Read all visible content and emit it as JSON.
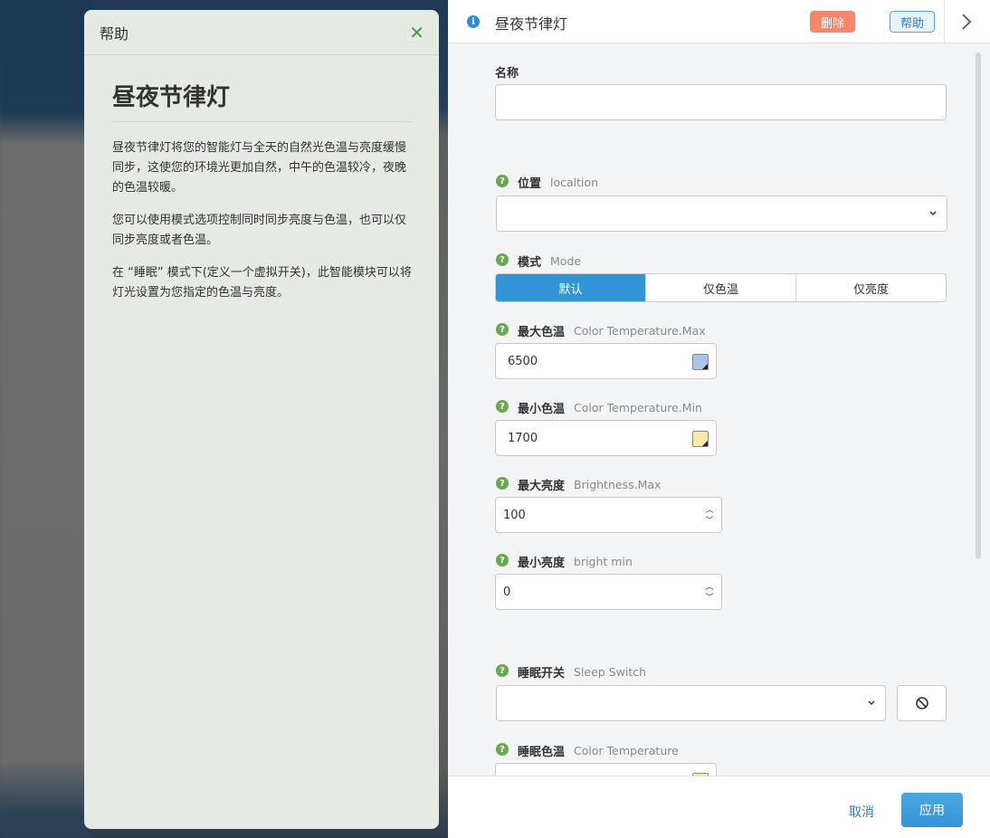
{
  "help": {
    "header_title": "帮助",
    "close_glyph": "✕",
    "title": "昼夜节律灯",
    "paragraphs": [
      "昼夜节律灯将您的智能灯与全天的自然光色温与亮度缓慢同步，这使您的环境光更加自然，中午的色温较冷，夜晚的色温较暖。",
      "您可以使用模式选项控制同时同步亮度与色温，也可以仅同步亮度或者色温。",
      "在 “睡眠” 模式下(定义一个虚拟开关)，此智能模块可以将灯光设置为您指定的色温与亮度。"
    ]
  },
  "panel": {
    "title": "昼夜节律灯",
    "delete_label": "删除",
    "help_label": "帮助",
    "info_glyph": "i"
  },
  "form": {
    "name": {
      "label": "名称",
      "value": ""
    },
    "location": {
      "label": "位置",
      "sub": "localtion",
      "value": ""
    },
    "mode": {
      "label": "模式",
      "sub": "Mode",
      "options": [
        "默认",
        "仅色温",
        "仅亮度"
      ],
      "selected": "默认"
    },
    "color_temp_max": {
      "label": "最大色温",
      "sub": "Color Temperature.Max",
      "value": "6500",
      "swatch": "#a9c6ea"
    },
    "color_temp_min": {
      "label": "最小色温",
      "sub": "Color Temperature.Min",
      "value": "1700",
      "swatch": "#fbe7a8"
    },
    "brightness_max": {
      "label": "最大亮度",
      "sub": "Brightness.Max",
      "value": "100"
    },
    "brightness_min": {
      "label": "最小亮度",
      "sub": "bright min",
      "value": "0"
    },
    "sleep_switch": {
      "label": "睡眠开关",
      "sub": "Sleep Switch",
      "value": ""
    },
    "sleep_color_temp": {
      "label": "睡眠色温",
      "sub": "Color Temperature",
      "swatch": "#fbe7a8"
    }
  },
  "footer": {
    "cancel_label": "取消",
    "apply_label": "应用"
  },
  "colors": {
    "accent": "#3394d6",
    "delete": "#f2876a",
    "help_icon": "#6aa84f",
    "help_panel_bg": "#e5ebe3"
  },
  "icons": [
    "close-icon",
    "info-icon",
    "chevron-right-icon",
    "help-question-icon",
    "chevron-down-icon",
    "color-picker-icon",
    "spinner-up-icon",
    "spinner-down-icon",
    "disable-icon"
  ]
}
